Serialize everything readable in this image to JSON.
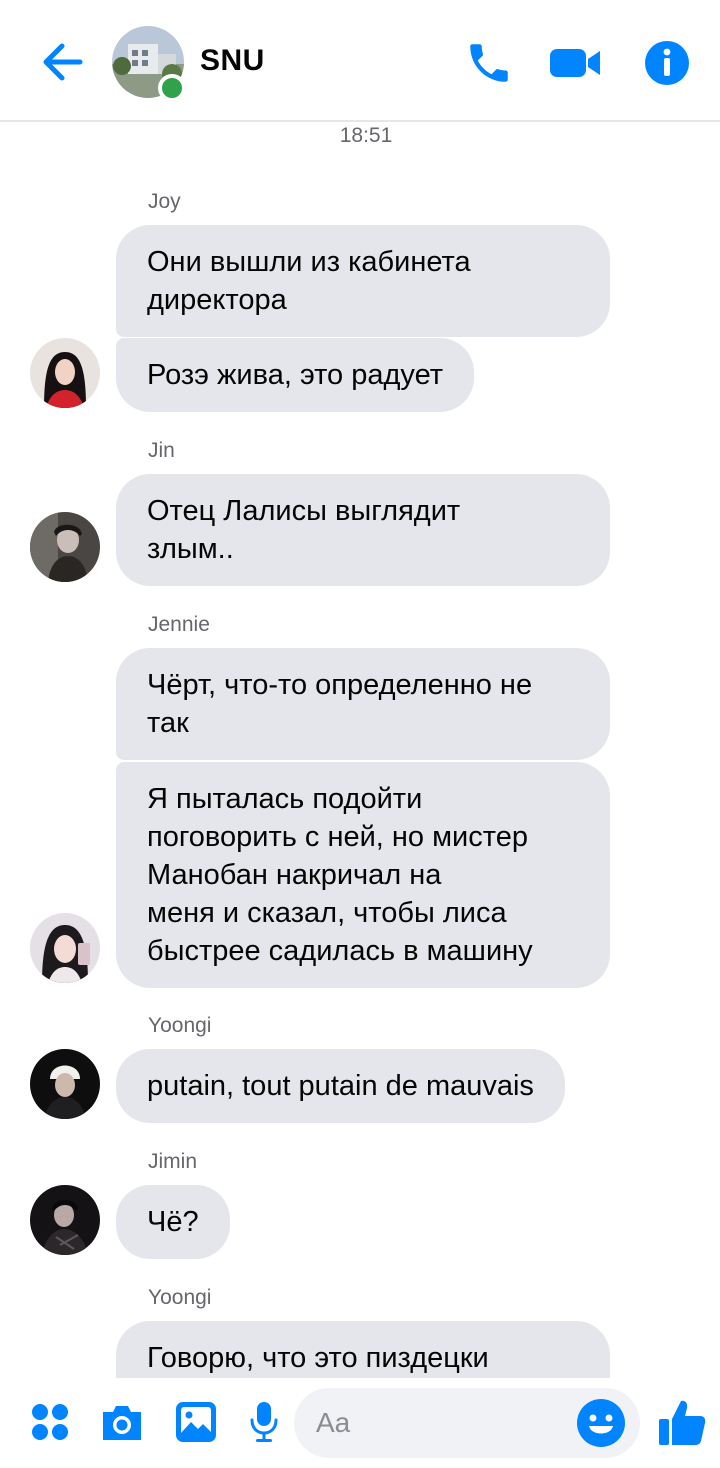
{
  "header": {
    "title": "SNU",
    "back_icon": "arrow-left-icon",
    "call_icon": "phone-icon",
    "video_icon": "video-camera-icon",
    "info_icon": "info-icon",
    "accent": "#0084ff",
    "online_color": "#31a24c"
  },
  "timestamp": "18:51",
  "messages": [
    {
      "sender": "Joy",
      "bubbles": [
        "Они вышли из кабинета\nдиректора",
        "Розэ жива, это радует"
      ]
    },
    {
      "sender": "Jin",
      "bubbles": [
        "Отец Лалисы выглядит\nзлым.."
      ]
    },
    {
      "sender": "Jennie",
      "bubbles": [
        "Чёрт, что-то определенно не\nтак",
        "Я пыталась подойти\nпоговорить с ней, но мистер\nМанобан накричал на\nменя и сказал, чтобы лиса\nбыстрее садилась в машину"
      ]
    },
    {
      "sender": "Yoongi",
      "bubbles": [
        "putain, tout putain de mauvais"
      ]
    },
    {
      "sender": "Jimin",
      "bubbles": [
        "Чё?"
      ]
    },
    {
      "sender": "Yoongi",
      "bubbles": [
        "Говорю, что это пиздецки"
      ]
    }
  ],
  "composer": {
    "placeholder": "Aa",
    "icons": [
      "apps-grid-icon",
      "camera-icon",
      "image-icon",
      "microphone-icon",
      "emoji-icon",
      "thumbs-up-icon"
    ],
    "bubble_color": "#e4e6eb"
  }
}
